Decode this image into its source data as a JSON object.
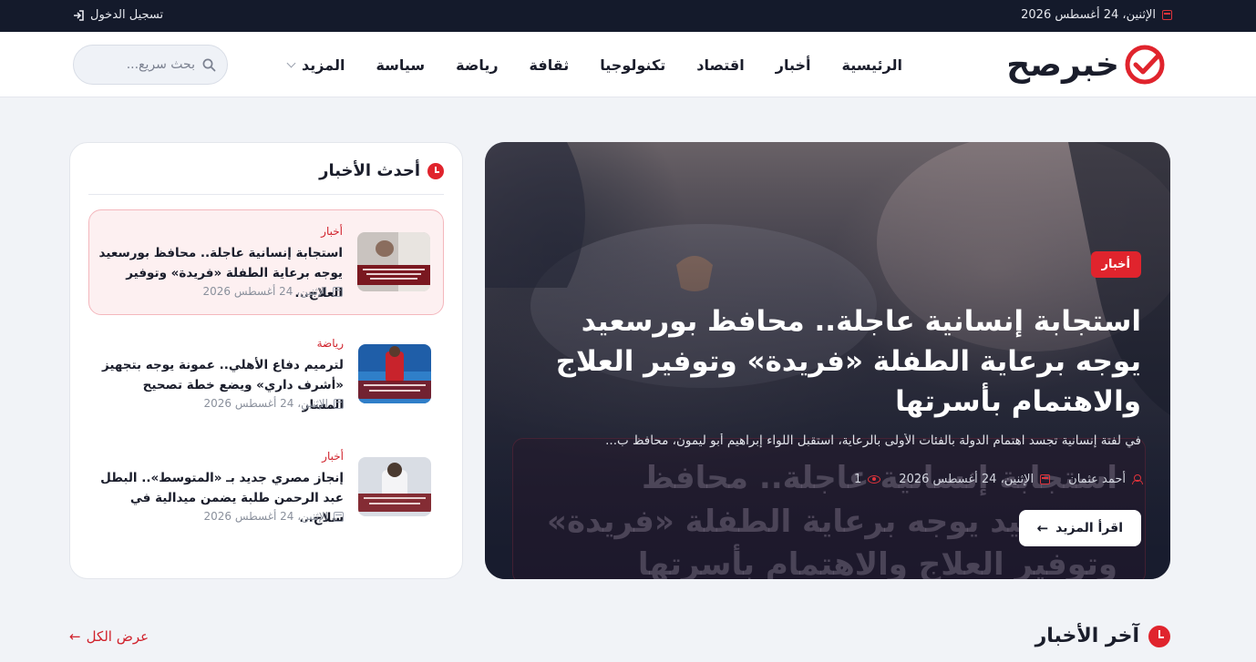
{
  "topbar": {
    "date": "الإثنين، 24 أغسطس 2026",
    "login_label": "تسجيل الدخول"
  },
  "header": {
    "logo_text": "خبرصح",
    "nav": [
      "الرئيسية",
      "أخبار",
      "اقتصاد",
      "تكنولوجيا",
      "ثقافة",
      "رياضة",
      "سياسة"
    ],
    "nav_more": "المزيد",
    "search_placeholder": "بحث سريع..."
  },
  "hero": {
    "category": "أخبار",
    "title": "استجابة إنسانية عاجلة.. محافظ بورسعيد يوجه برعاية الطفلة «فريدة» وتوفير العلاج والاهتمام بأسرتها",
    "excerpt": "في لفتة إنسانية تجسد اهتمام الدولة بالفئات الأولى بالرعاية، استقبل اللواء إبراهيم أبو ليمون، محافظ ب...",
    "author": "أحمد عثمان",
    "date": "الإثنين، 24 أغسطس 2026",
    "views": "1",
    "read_more": "اقرأ المزيد"
  },
  "latest": {
    "heading": "أحدث الأخبار",
    "items": [
      {
        "category": "أخبار",
        "title": "استجابة إنسانية عاجلة.. محافظ بورسعيد يوجه برعاية الطفلة «فريدة» وتوفير العلاج...",
        "date": "الإثنين، 24 أغسطس 2026"
      },
      {
        "category": "رياضة",
        "title": "لترميم دفاع الأهلي.. عمونة يوجه بتجهيز «أشرف داري» ويضع خطة تصحيح المسار",
        "date": "الإثنين، 24 أغسطس 2026"
      },
      {
        "category": "أخبار",
        "title": "إنجاز مصري جديد بـ «المتوسط».. البطل عبد الرحمن طلبة يضمن ميدالية في سلاح...",
        "date": "الإثنين، 24 أغسطس 2026"
      }
    ]
  },
  "section": {
    "title": "آخر الأخبار",
    "view_all": "عرض الكل"
  },
  "colors": {
    "accent": "#e0242d",
    "topbar": "#141a2b"
  }
}
